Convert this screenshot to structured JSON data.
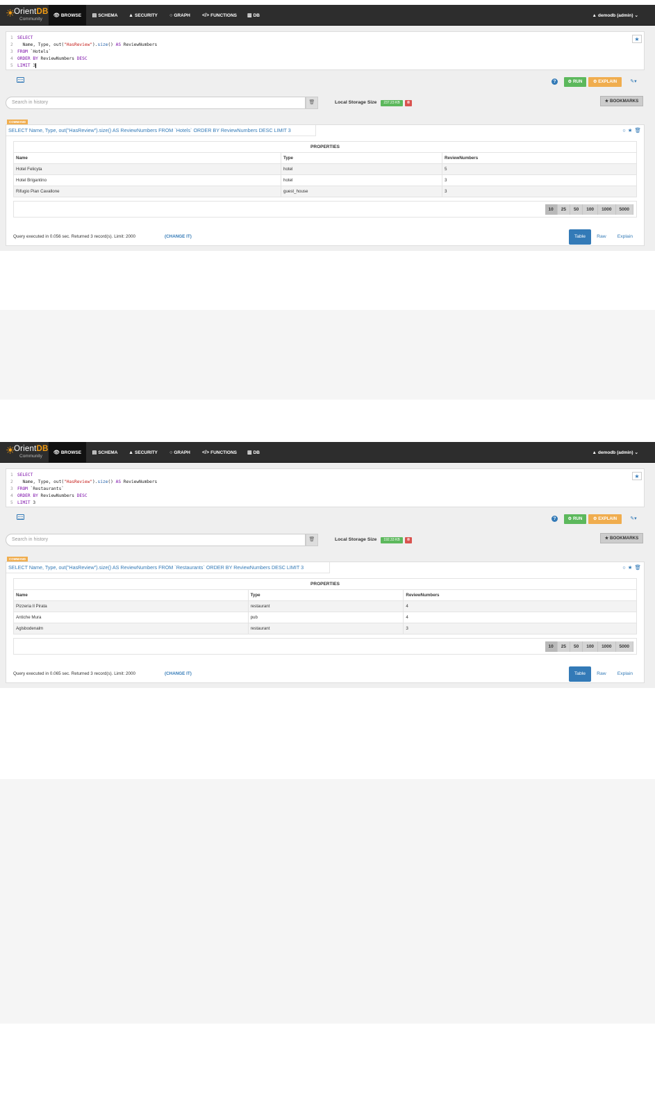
{
  "navbar": {
    "logo_brand": "Orient",
    "logo_brand_accent": "DB",
    "logo_sub": "Community",
    "items": [
      {
        "icon": "eye-icon",
        "glyph": "👁",
        "label": "BROWSE"
      },
      {
        "icon": "schema-icon",
        "glyph": "▤",
        "label": "SCHEMA"
      },
      {
        "icon": "user-icon",
        "glyph": "▲",
        "label": "SECURITY"
      },
      {
        "icon": "graph-icon",
        "glyph": "○",
        "label": "GRAPH"
      },
      {
        "icon": "code-icon",
        "glyph": "</>",
        "label": "FUNCTIONS"
      },
      {
        "icon": "database-icon",
        "glyph": "▥",
        "label": "DB"
      }
    ],
    "user": "demodb (admin)"
  },
  "shots": [
    {
      "editor_lines": [
        "SELECT",
        "  Name, Type, out(\"HasReview\").size() AS ReviewNumbers",
        "FROM `Hotels`",
        "ORDER BY ReviewNumbers DESC",
        "LIMIT 3"
      ],
      "buttons": {
        "run": "RUN",
        "explain": "EXPLAIN",
        "bookmarks": "BOOKMARKS"
      },
      "history_placeholder": "Search in history",
      "storage_label": "Local Storage Size",
      "storage_value": "237.23 KB",
      "command_badge": "COMMAND",
      "query": "SELECT Name, Type, out(\"HasReview\").size() AS ReviewNumbers FROM `Hotels` ORDER BY ReviewNumbers DESC LIMIT 3",
      "table_caption": "PROPERTIES",
      "columns": [
        "Name",
        "Type",
        "ReviewNumbers"
      ],
      "rows": [
        [
          "Hotel Felicyta",
          "hotel",
          "5"
        ],
        [
          "Hotel Brigantino",
          "hotel",
          "3"
        ],
        [
          "Rifugio Pian Cavallone",
          "guest_house",
          "3"
        ]
      ],
      "page_sizes": [
        "10",
        "25",
        "50",
        "100",
        "1000",
        "5000"
      ],
      "footer": "Query executed in 0.056 sec. Returned 3 record(s). Limit: 2000",
      "change_it": "(CHANGE IT)",
      "view_tabs": [
        "Table",
        "Raw",
        "Explain"
      ]
    },
    {
      "editor_lines": [
        "SELECT",
        "  Name, Type, out(\"HasReview\").size() AS ReviewNumbers",
        "FROM `Restaurants`",
        "ORDER BY ReviewNumbers DESC",
        "LIMIT 3"
      ],
      "buttons": {
        "run": "RUN",
        "explain": "EXPLAIN",
        "bookmarks": "BOOKMARKS"
      },
      "history_placeholder": "Search in history",
      "storage_label": "Local Storage Size",
      "storage_value": "192.33 KB",
      "command_badge": "COMMAND",
      "query": "SELECT Name, Type, out(\"HasReview\").size() AS ReviewNumbers FROM `Restaurants` ORDER BY ReviewNumbers DESC LIMIT 3",
      "table_caption": "PROPERTIES",
      "columns": [
        "Name",
        "Type",
        "ReviewNumbers"
      ],
      "rows": [
        [
          "Pizzeria Il Pirata",
          "restaurant",
          "4"
        ],
        [
          "Antiche Mura",
          "pub",
          "4"
        ],
        [
          "Aglsbodenalm",
          "restaurant",
          "3"
        ]
      ],
      "page_sizes": [
        "10",
        "25",
        "50",
        "100",
        "1000",
        "5000"
      ],
      "footer": "Query executed in 0.065 sec. Returned 3 record(s). Limit: 2000",
      "change_it": "(CHANGE IT)",
      "view_tabs": [
        "Table",
        "Raw",
        "Explain"
      ]
    }
  ]
}
